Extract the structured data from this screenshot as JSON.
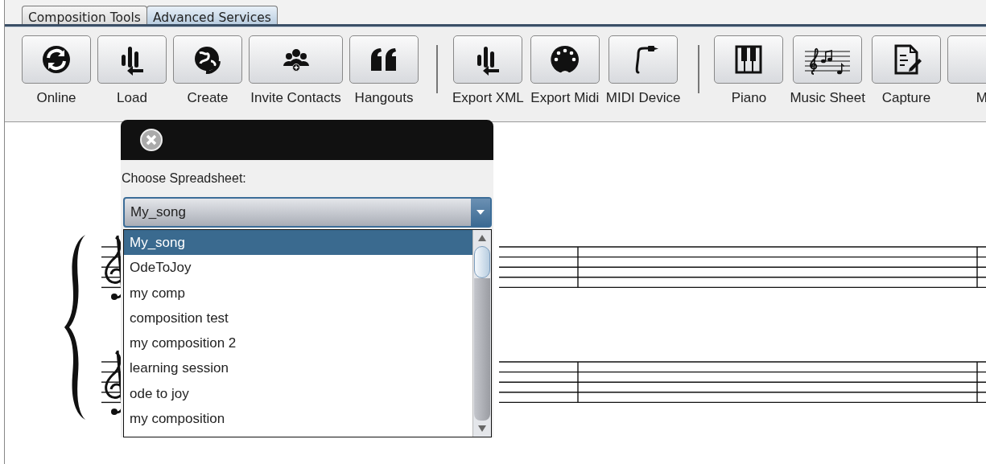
{
  "tabs": [
    {
      "label": "Composition Tools",
      "selected": false
    },
    {
      "label": "Advanced Services",
      "selected": true
    }
  ],
  "toolbar": [
    {
      "items": [
        {
          "label": "Online"
        },
        {
          "label": "Load"
        },
        {
          "label": "Create"
        },
        {
          "label": "Invite Contacts"
        },
        {
          "label": "Hangouts"
        }
      ]
    },
    {
      "items": [
        {
          "label": "Export XML"
        },
        {
          "label": "Export Midi"
        },
        {
          "label": "MIDI Device"
        }
      ]
    },
    {
      "items": [
        {
          "label": "Piano"
        },
        {
          "label": "Music Sheet"
        },
        {
          "label": "Capture"
        },
        {
          "label": "M"
        }
      ]
    }
  ],
  "dialog": {
    "label": "Choose Spreadsheet:",
    "combo": {
      "value": "My_song"
    },
    "options": [
      {
        "label": "My_song",
        "selected": true
      },
      {
        "label": "OdeToJoy",
        "selected": false
      },
      {
        "label": "my comp",
        "selected": false
      },
      {
        "label": "composition test",
        "selected": false
      },
      {
        "label": "my composition 2",
        "selected": false
      },
      {
        "label": "learning session",
        "selected": false
      },
      {
        "label": "ode to joy",
        "selected": false
      },
      {
        "label": "my composition",
        "selected": false
      }
    ]
  }
}
